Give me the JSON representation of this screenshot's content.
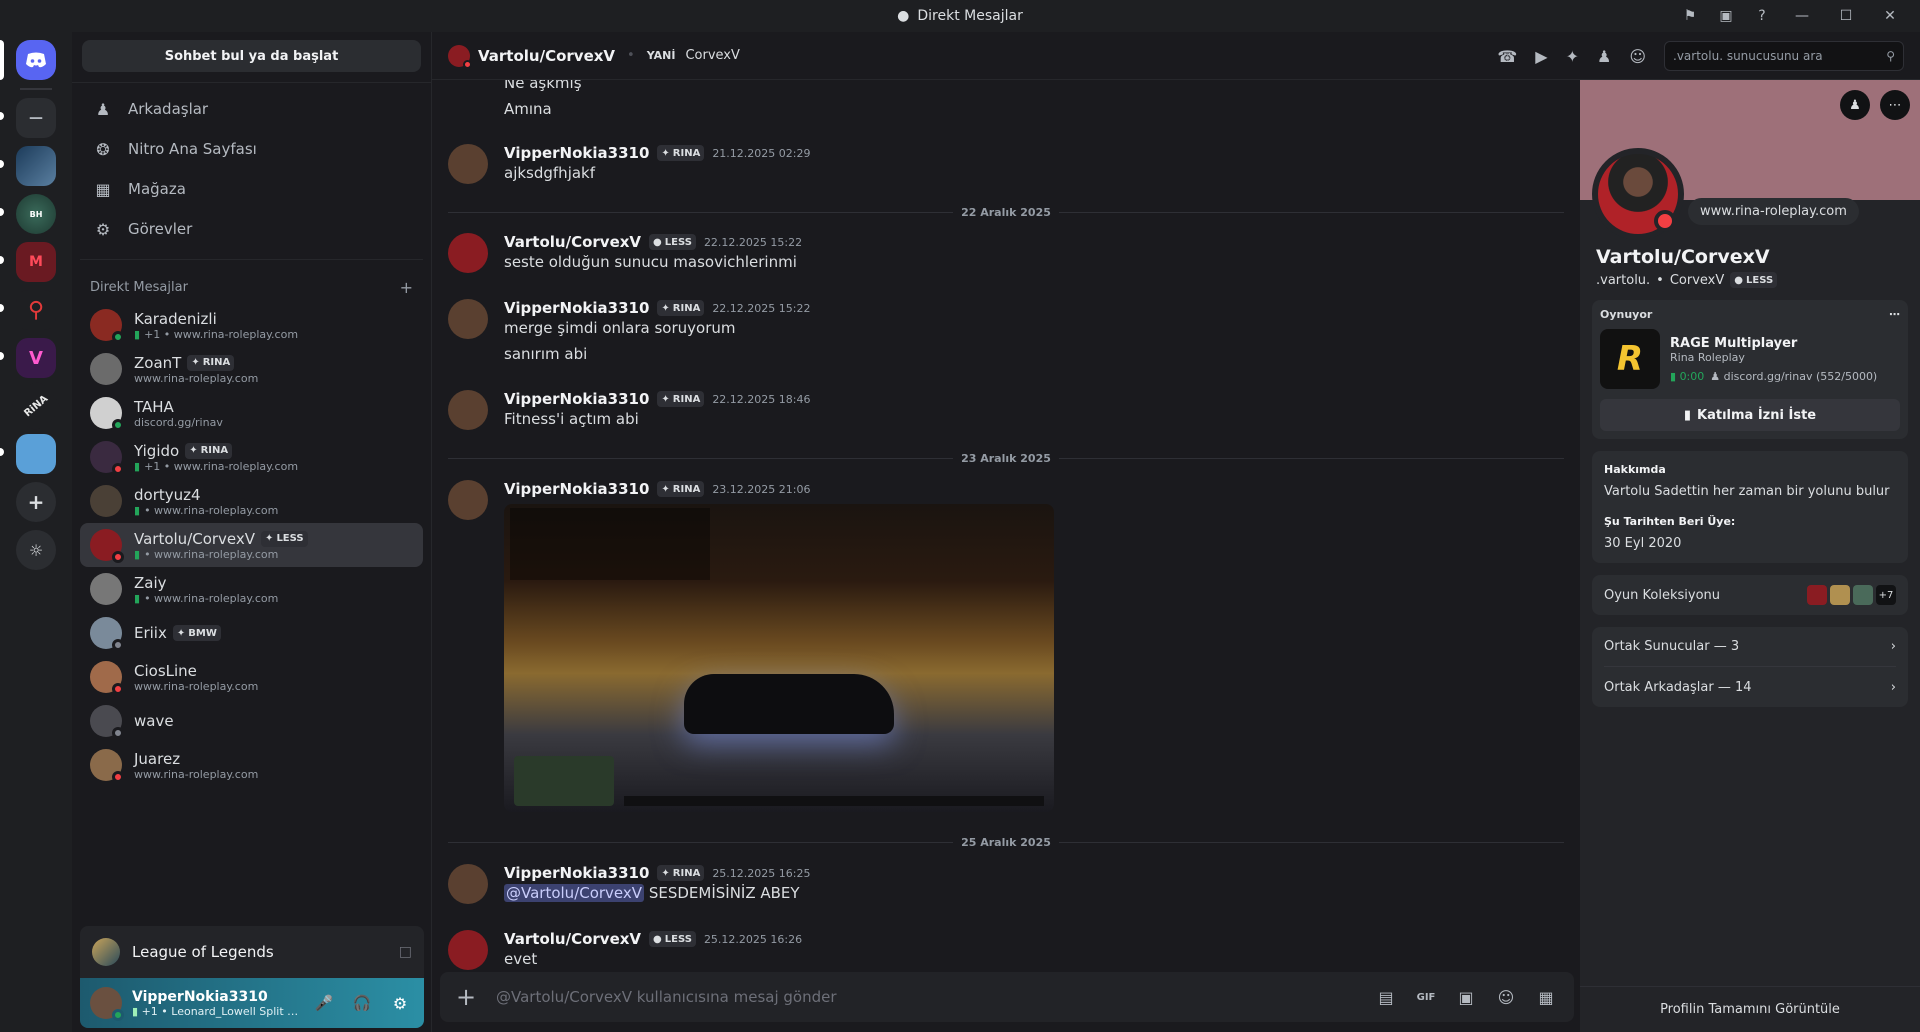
{
  "window": {
    "title": "Direkt Mesajlar"
  },
  "channels": {
    "find_button": "Sohbet bul ya da başlat",
    "nav": [
      {
        "label": "Arkadaşlar",
        "icon": "friends-icon"
      },
      {
        "label": "Nitro Ana Sayfası",
        "icon": "nitro-icon"
      },
      {
        "label": "Mağaza",
        "icon": "shop-icon"
      },
      {
        "label": "Görevler",
        "icon": "quests-icon"
      }
    ],
    "dm_header": "Direkt Mesajlar",
    "dms": [
      {
        "name": "Karadenizli",
        "tag": "",
        "sub": "+1 • www.rina-roleplay.com",
        "game": true,
        "status": "#23a55a",
        "color": "#8a2a22"
      },
      {
        "name": "ZoanT",
        "tag": "RINA",
        "sub": "www.rina-roleplay.com",
        "game": false,
        "status": "",
        "color": "#6b6b6b"
      },
      {
        "name": "TAHA",
        "tag": "",
        "sub": "discord.gg/rinav",
        "game": false,
        "status": "#23a55a",
        "color": "#d0d0d0"
      },
      {
        "name": "Yigido",
        "tag": "RINA",
        "sub": "+1 • www.rina-roleplay.com",
        "game": true,
        "status": "#f23f43",
        "color": "#3a2a40"
      },
      {
        "name": "dortyuz4",
        "tag": "",
        "sub": "• www.rina-roleplay.com",
        "game": true,
        "status": "",
        "color": "#4a4036"
      },
      {
        "name": "Vartolu/CorvexV",
        "tag": "LESS",
        "sub": "• www.rina-roleplay.com",
        "game": true,
        "status": "#f23f43",
        "color": "#8a1c22"
      },
      {
        "name": "Zaiy",
        "tag": "",
        "sub": "• www.rina-roleplay.com",
        "game": true,
        "status": "",
        "color": "#777777"
      },
      {
        "name": "Eriix",
        "tag": "BMW",
        "sub": "",
        "game": false,
        "status": "#80848e",
        "color": "#7a8a9a"
      },
      {
        "name": "CiosLine",
        "tag": "",
        "sub": "www.rina-roleplay.com",
        "game": false,
        "status": "#f23f43",
        "color": "#a06a4a"
      },
      {
        "name": "wave",
        "tag": "",
        "sub": "",
        "game": false,
        "status": "#80848e",
        "color": "#4a4a50"
      },
      {
        "name": "Juarez",
        "tag": "",
        "sub": "www.rina-roleplay.com",
        "game": false,
        "status": "#f23f43",
        "color": "#8a6a4a"
      }
    ]
  },
  "game_panel": {
    "name": "League of Legends"
  },
  "user_panel": {
    "name": "VipperNokia3310",
    "status": "+1 • Leonard_Lowell Split Side Fitness ..."
  },
  "header": {
    "name": "Vartolu/CorvexV",
    "aka_label": "YANİ",
    "aka": "CorvexV",
    "search_placeholder": ".vartolu. sunucusunu ara"
  },
  "messages": {
    "top_lines": [
      "Ne aşkmış",
      "Amına"
    ],
    "m1": {
      "author": "VipperNokia3310",
      "tag": "RINA",
      "time": "21.12.2025 02:29",
      "text": "ajksdgfhjakf"
    },
    "date1": "22 Aralık 2025",
    "m2": {
      "author": "Vartolu/CorvexV",
      "tag": "LESS",
      "time": "22.12.2025 15:22",
      "text": "seste olduğun sunucu masovichlerinmi"
    },
    "m3": {
      "author": "VipperNokia3310",
      "tag": "RINA",
      "time": "22.12.2025 15:22",
      "text": "merge şimdi onlara soruyorum",
      "text2": "sanırım abi"
    },
    "m4": {
      "author": "VipperNokia3310",
      "tag": "RINA",
      "time": "22.12.2025 18:46",
      "text": "Fitness'i açtım abi"
    },
    "date2": "23 Aralık 2025",
    "m5": {
      "author": "VipperNokia3310",
      "tag": "RINA",
      "time": "23.12.2025 21:06"
    },
    "date3": "25 Aralık 2025",
    "m6": {
      "author": "VipperNokia3310",
      "tag": "RINA",
      "time": "25.12.2025 16:25",
      "mention": "@Vartolu/CorvexV",
      "text": "SESDEMİSİNİZ ABEY"
    },
    "m7": {
      "author": "Vartolu/CorvexV",
      "tag": "LESS",
      "time": "25.12.2025 16:26",
      "text": "evet"
    }
  },
  "composer": {
    "placeholder": "@Vartolu/CorvexV kullanıcısına mesaj gönder"
  },
  "profile": {
    "bubble": "www.rina-roleplay.com",
    "display_name": "Vartolu/CorvexV",
    "username": ".vartolu.",
    "pronoun": "CorvexV",
    "tag": "LESS",
    "activity_label": "Oynuyor",
    "game_title": "RAGE Multiplayer",
    "game_sub": "Rina Roleplay",
    "game_time": "0:00",
    "game_server": "discord.gg/rinav (552/5000)",
    "join_button": "Katılma İzni İste",
    "about_label": "Hakkımda",
    "about_text": "Vartolu Sadettin her zaman bir yolunu bulur",
    "member_since_label": "Şu Tarihten Beri Üye:",
    "member_since": "30 Eyl 2020",
    "collection_label": "Oyun Koleksiyonu",
    "collection_more": "+7",
    "mutual_servers": "Ortak Sunucular — 3",
    "mutual_friends": "Ortak Arkadaşlar — 14",
    "view_full": "Profilin Tamamını Görüntüle"
  }
}
